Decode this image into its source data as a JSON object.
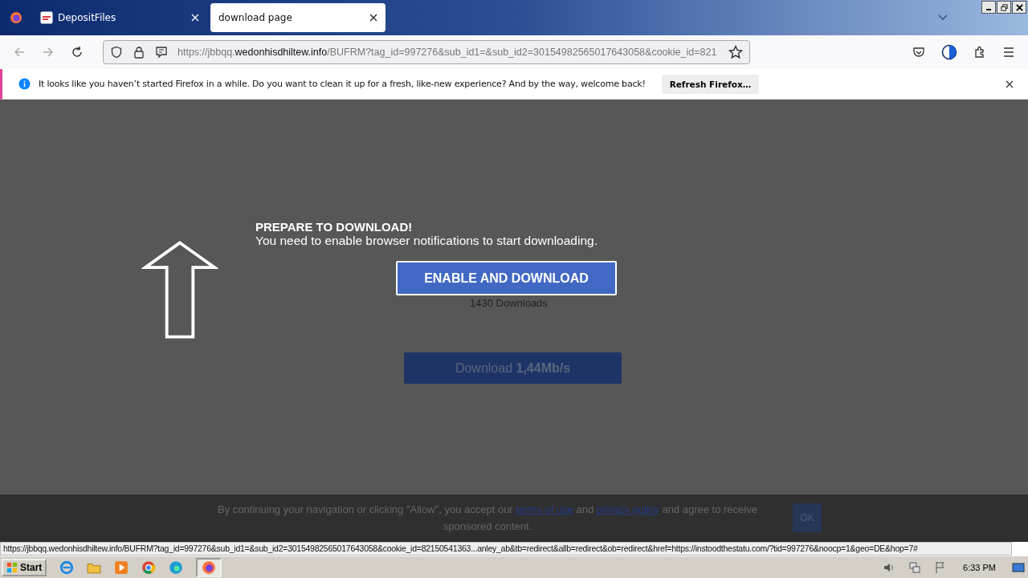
{
  "tabs": [
    {
      "label": "DepositFiles",
      "selected": false
    },
    {
      "label": "download page",
      "selected": true
    }
  ],
  "address": {
    "prefix": "https://jbbqq.",
    "domain": "wedonhisdhiltew.info",
    "rest": "/BUFRM?tag_id=997276&sub_id1=&sub_id2=30154982565017643058&cookie_id=821"
  },
  "notification": {
    "text": "It looks like you haven’t started Firefox in a while. Do you want to clean it up for a fresh, like-new experience? And by the way, welcome back!",
    "button": "Refresh Firefox…"
  },
  "page": {
    "heading": "PREPARE TO DOWNLOAD!",
    "message": "You need to enable browser notifications to start downloading.",
    "enable_button": "ENABLE AND DOWNLOAD",
    "downloads_count": "1430 Downloads",
    "download_button": "Download **1,44Mb/s**"
  },
  "cookie_bar": {
    "text_before": "By continuing your navigation or clicking \"Allow\", you accept our",
    "terms_link": "terms of use",
    "text_middle": "and",
    "privacy_link": "privacy policy",
    "text_after": "and agree to receive sponsored content.",
    "ok_button": "OK"
  },
  "status_url": "https://jbbqq.wedonhisdhiltew.info/BUFRM?tag_id=997276&sub_id1=&sub_id2=30154982565017643058&cookie_id=82150541363...anley_ab&tb=redirect&allb=redirect&ob=redirect&href=https://instoodthestatu.com/?tid=997276&noocp=1&geo=DE&hop=7#",
  "taskbar": {
    "start": "Start",
    "clock": "6:33 PM"
  }
}
